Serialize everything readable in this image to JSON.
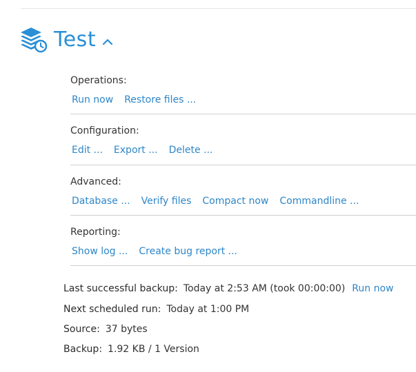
{
  "backup": {
    "name": "Test"
  },
  "sections": {
    "operations": {
      "label": "Operations:",
      "links": [
        "Run now",
        "Restore files ..."
      ]
    },
    "configuration": {
      "label": "Configuration:",
      "links": [
        "Edit ...",
        "Export ...",
        "Delete ..."
      ]
    },
    "advanced": {
      "label": "Advanced:",
      "links": [
        "Database ...",
        "Verify files",
        "Compact now",
        "Commandline ..."
      ]
    },
    "reporting": {
      "label": "Reporting:",
      "links": [
        "Show log ...",
        "Create bug report ..."
      ]
    }
  },
  "info": {
    "last_backup_label": "Last successful backup:",
    "last_backup_value": "Today at 2:53 AM (took 00:00:00)",
    "run_now": "Run now",
    "next_run_label": "Next scheduled run:",
    "next_run_value": "Today at 1:00 PM",
    "source_label": "Source:",
    "source_value": "37 bytes",
    "backup_label": "Backup:",
    "backup_value": "1.92 KB / 1 Version"
  },
  "colors": {
    "accent": "#2a8fd6",
    "link": "#2e86c8",
    "text": "#333333",
    "divider": "#cfcfcf"
  },
  "icons": {
    "header": "database-clock-icon",
    "toggle": "chevron-up-icon"
  }
}
